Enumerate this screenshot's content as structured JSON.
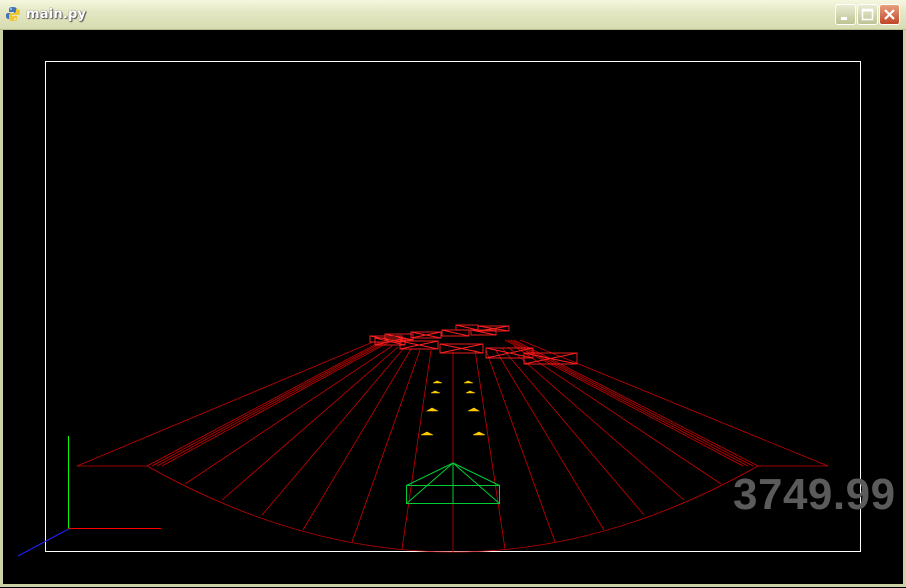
{
  "window": {
    "title": "main.py",
    "icon": "python-icon",
    "buttons": {
      "minimize": "minimize-icon",
      "maximize": "maximize-icon",
      "close": "close-icon"
    }
  },
  "hud": {
    "score": "3749.99"
  },
  "colors": {
    "titlebar": "#e5e8c4",
    "background": "#000000",
    "border": "#ffffff",
    "track": "#cc0000",
    "player": "#00cc33",
    "pickups": "#ffcc00",
    "axis_x": "#ff0000",
    "axis_y": "#00ff00",
    "axis_z": "#0000ff",
    "score": "#5b5b5b"
  }
}
